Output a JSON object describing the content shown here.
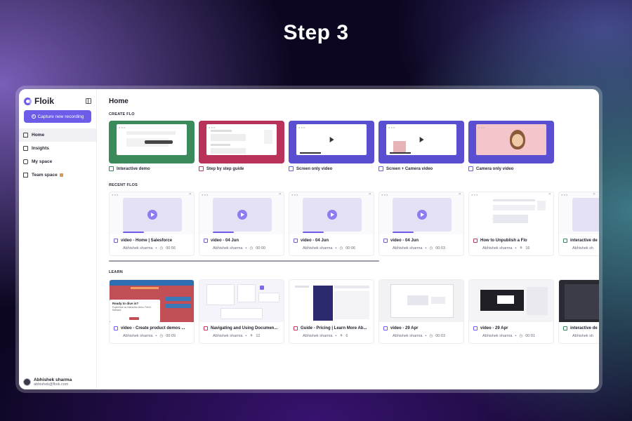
{
  "banner": {
    "title": "Step 3"
  },
  "app": {
    "name": "Floik",
    "capture_label": "Capture new recording",
    "nav": [
      {
        "label": "Home"
      },
      {
        "label": "Insights"
      },
      {
        "label": "My space"
      },
      {
        "label": "Team space"
      }
    ],
    "user": {
      "name": "Abhishek sharma",
      "email": "abhishek@floik.com"
    }
  },
  "main": {
    "title": "Home",
    "create_label": "CREATE FLO",
    "create": [
      {
        "label": "Interactive demo",
        "color": "#3a8a5b"
      },
      {
        "label": "Step by step guide",
        "color": "#b8325a"
      },
      {
        "label": "Screen only video",
        "color": "#5a4fd0"
      },
      {
        "label": "Screen + Camera video",
        "color": "#5a4fd0"
      },
      {
        "label": "Camera only video",
        "color": "#5a4fd0"
      }
    ],
    "recent_label": "RECENT FLOS",
    "recent": [
      {
        "title": "video - Home | Salesforce",
        "author": "Abhishek sharma",
        "stat": "00:56",
        "kind": "video"
      },
      {
        "title": "video - 04 Jun",
        "author": "Abhishek sharma",
        "stat": "00:00",
        "kind": "video"
      },
      {
        "title": "video - 04 Jun",
        "author": "Abhishek sharma",
        "stat": "00:06",
        "kind": "video"
      },
      {
        "title": "video - 04 Jun",
        "author": "Abhishek sharma",
        "stat": "00:03",
        "kind": "video"
      },
      {
        "title": "How to Unpublish a Flo",
        "author": "Abhishek sharma",
        "stat": "16",
        "kind": "doc"
      },
      {
        "title": "interactive de",
        "author": "Abhishek sh",
        "stat": "",
        "kind": "interactive"
      }
    ],
    "learn_label": "LEARN",
    "learn": [
      {
        "title": "video - Create product demos ...",
        "author": "Abhishek sharma",
        "stat": "00:09",
        "kind": "video",
        "overlay_title": "Ready to dive in?",
        "overlay_text": "Experience an interactive demo. Feel it firsthand."
      },
      {
        "title": "Navigating and Using Documen...",
        "author": "Abhishek sharma",
        "stat": "12",
        "kind": "doc"
      },
      {
        "title": "Guide - Pricing | Learn More Ab...",
        "author": "Abhishek sharma",
        "stat": "6",
        "kind": "doc"
      },
      {
        "title": "video - 29 Apr",
        "author": "Abhishek sharma",
        "stat": "00:03",
        "kind": "video"
      },
      {
        "title": "video - 29 Apr",
        "author": "Abhishek sharma",
        "stat": "00:01",
        "kind": "video"
      },
      {
        "title": "interactive de",
        "author": "Abhishek sh",
        "stat": "",
        "kind": "interactive"
      }
    ]
  }
}
